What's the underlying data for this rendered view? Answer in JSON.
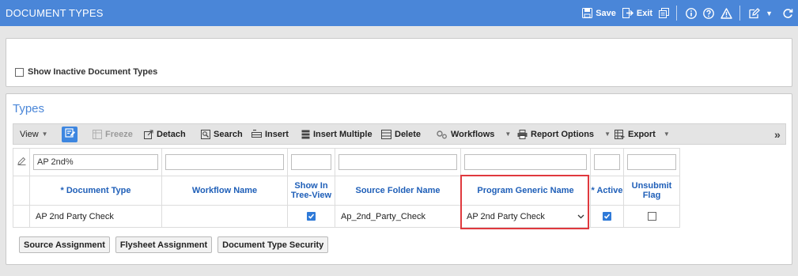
{
  "window": {
    "title": "DOCUMENT TYPES",
    "save_label": "Save",
    "exit_label": "Exit",
    "colors": {
      "titlebar": "#4a86d8",
      "accent": "#3d86e0",
      "highlight": "#e0393e",
      "header_text": "#1f5fb8"
    }
  },
  "filter": {
    "show_inactive_label": "Show Inactive Document Types",
    "show_inactive_checked": false
  },
  "types": {
    "title": "Types",
    "toolbar": {
      "view_label": "View",
      "freeze_label": "Freeze",
      "detach_label": "Detach",
      "search_label": "Search",
      "insert_label": "Insert",
      "insert_multiple_label": "Insert Multiple",
      "delete_label": "Delete",
      "workflows_label": "Workflows",
      "report_options_label": "Report Options",
      "export_label": "Export",
      "more_label": "»"
    },
    "columns": {
      "document_type": "* Document Type",
      "workflow_name": "Workflow Name",
      "show_in_tree_view": "Show In Tree-View",
      "source_folder_name": "Source Folder Name",
      "program_generic_name": "Program Generic Name",
      "active": "* Active",
      "unsubmit_flag": "Unsubmit Flag"
    },
    "filter_row": {
      "document_type": "AP 2nd%"
    },
    "rows": [
      {
        "document_type": "AP 2nd Party Check",
        "workflow_name": "",
        "show_in_tree_view": true,
        "source_folder_name": "Ap_2nd_Party_Check",
        "program_generic_name": "AP 2nd Party Check",
        "active": true,
        "unsubmit_flag": false
      }
    ]
  },
  "buttons": {
    "source_assignment": "Source Assignment",
    "flysheet_assignment": "Flysheet Assignment",
    "document_type_security": "Document Type Security"
  }
}
